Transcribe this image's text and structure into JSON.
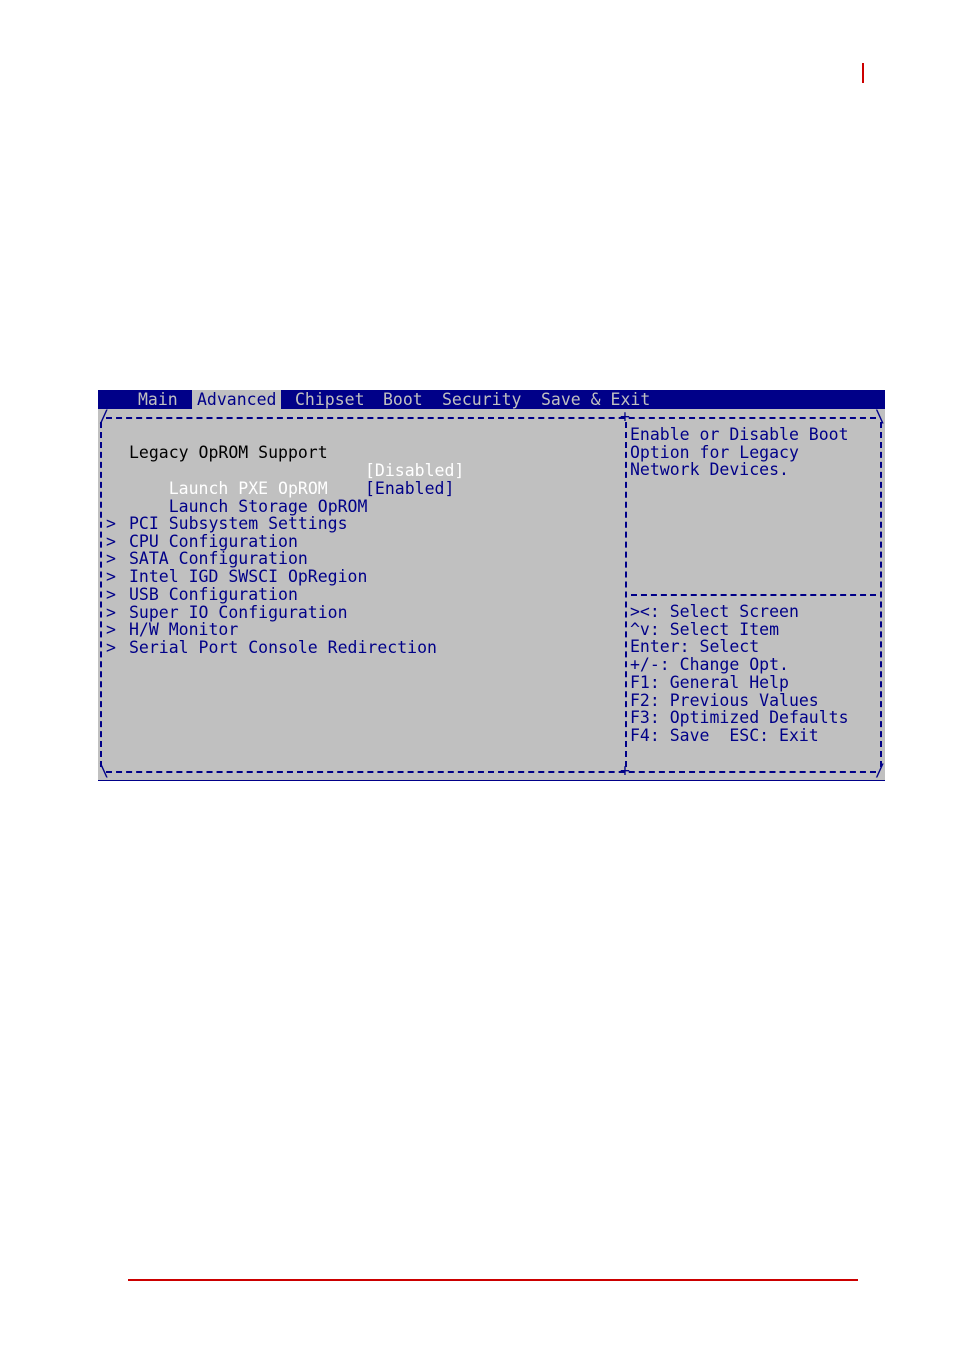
{
  "page": {
    "accent_color": "#cc0000"
  },
  "bios": {
    "colors": {
      "background": "#c0c0c0",
      "text": "#000088",
      "highlight": "#ffffff",
      "heading": "#000000"
    },
    "tabs": [
      {
        "label": "Main",
        "active": false
      },
      {
        "label": "Advanced",
        "active": true
      },
      {
        "label": "Chipset",
        "active": false
      },
      {
        "label": "Boot",
        "active": false
      },
      {
        "label": "Security",
        "active": false
      },
      {
        "label": "Save & Exit",
        "active": false
      }
    ],
    "section_title": "Legacy OpRom Support",
    "section_title_display": "Legacy OpROM Support",
    "settings": [
      {
        "label": "Launch PXE OpROM",
        "value": "[Disabled]",
        "selected": true
      },
      {
        "label": "Launch Storage OpROM",
        "value": "[Enabled]",
        "selected": false
      }
    ],
    "submenus": [
      {
        "prefix": ">",
        "label": "PCI Subsystem Settings"
      },
      {
        "prefix": ">",
        "label": "CPU Configuration"
      },
      {
        "prefix": ">",
        "label": "SATA Configuration"
      },
      {
        "prefix": ">",
        "label": "Intel IGD SWSCI OpRegion"
      },
      {
        "prefix": ">",
        "label": "USB Configuration"
      },
      {
        "prefix": ">",
        "label": "Super IO Configuration"
      },
      {
        "prefix": ">",
        "label": "H/W Monitor"
      },
      {
        "prefix": ">",
        "label": "Serial Port Console Redirection"
      }
    ],
    "help_text": [
      "Enable or Disable Boot",
      "Option for Legacy",
      "Network Devices."
    ],
    "key_help": [
      "><: Select Screen",
      "^v: Select Item",
      "Enter: Select",
      "+/-: Change Opt.",
      "F1: General Help",
      "F2: Previous Values",
      "F3: Optimized Defaults",
      "F4: Save  ESC: Exit"
    ]
  }
}
